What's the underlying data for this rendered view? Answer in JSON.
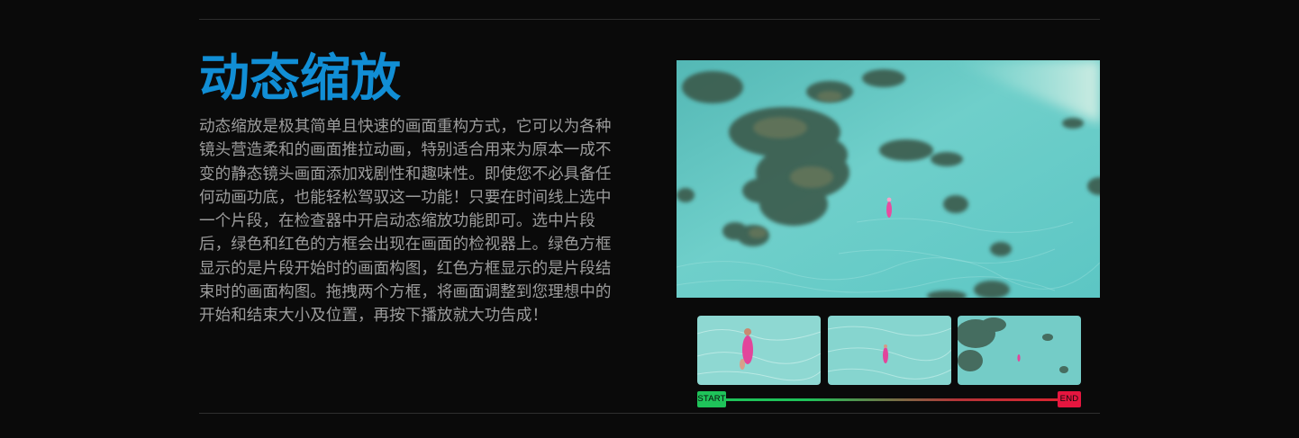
{
  "section": {
    "title": "动态缩放",
    "description": "动态缩放是极其简单且快速的画面重构方式，它可以为各种镜头营造柔和的画面推拉动画，特别适合用来为原本一成不变的静态镜头画面添加戏剧性和趣味性。即使您不必具备任何动画功底，也能轻松驾驭这一功能！只要在时间线上选中一个片段，在检查器中开启动态缩放功能即可。选中片段后，绿色和红色的方框会出现在画面的检视器上。绿色方框显示的是片段开始时的画面构图，红色方框显示的是片段结束时的画面构图。拖拽两个方框，将画面调整到您理想中的开始和结束大小及位置，再按下播放就大功告成！"
  },
  "timeline": {
    "start_label": "START",
    "end_label": "END"
  },
  "colors": {
    "title": "#118ed5",
    "body_text": "#9c9c9c",
    "background": "#0a0a0a",
    "start_marker": "#1fc35a",
    "end_marker": "#e5163f"
  }
}
